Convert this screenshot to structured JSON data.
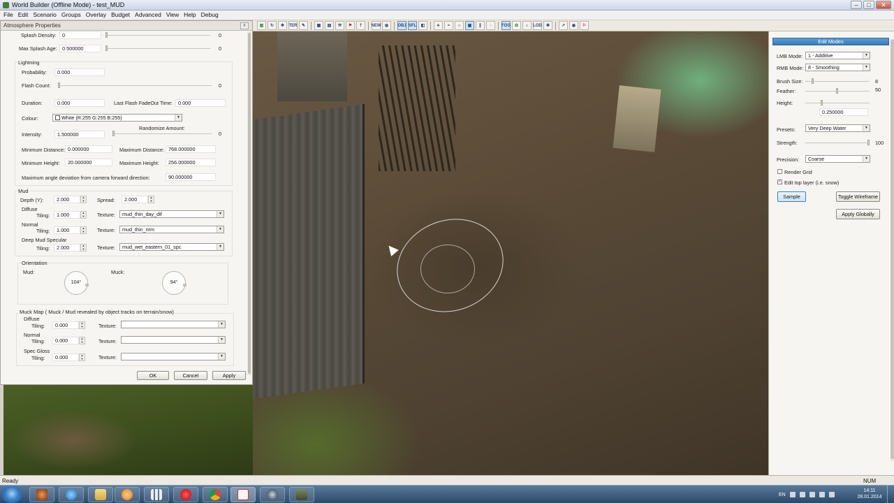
{
  "window": {
    "title": "World Builder (Offline Mode) - test_MUD"
  },
  "menu": [
    "File",
    "Edit",
    "Scenario",
    "Groups",
    "Overlay",
    "Budget",
    "Advanced",
    "View",
    "Help",
    "Debug"
  ],
  "toolbar_labels": {
    "ter": "TER",
    "new": "NEW",
    "obj": "OBJ",
    "sfl": "SFL",
    "fog": "FOG",
    "lod": "LOD"
  },
  "atmosphere": {
    "title": "Atmosphere Properties",
    "close": "x",
    "splash_density_label": "Splash Density:",
    "splash_density_value": "0",
    "splash_density_slider": "0",
    "max_splash_age_label": "Max Splash Age:",
    "max_splash_age_value": "0.500000",
    "max_splash_age_slider": "0",
    "lightning": {
      "section": "Lightning",
      "probability_label": "Probability:",
      "probability_value": "0.000",
      "flash_count_label": "Flash Count:",
      "flash_count_slider": "0",
      "duration_label": "Duration:",
      "duration_value": "0.000",
      "last_flash_label": "Last Flash FadeOut Time:",
      "last_flash_value": "0.000",
      "colour_label": "Colour:",
      "colour_value": "White (R:255 G:255 B:255)",
      "randomize_label": "Randomize Amount:",
      "intensity_label": "Intensity:",
      "intensity_value": "1.500000",
      "randomize_slider": "0",
      "min_distance_label": "Minimum Distance:",
      "min_distance_value": "0.000000",
      "max_distance_label": "Maximum Distance:",
      "max_distance_value": "768.000000",
      "min_height_label": "Minimum Height:",
      "min_height_value": "20.000000",
      "max_height_label": "Maximum Height:",
      "max_height_value": "256.000000",
      "max_angle_label": "Maximum angle deviation from camera forward direction:",
      "max_angle_value": "90.000000"
    },
    "mud": {
      "section": "Mud",
      "depth_label": "Depth (Y):",
      "depth_value": "2.000",
      "spread_label": "Spread:",
      "spread_value": "2.000",
      "diffuse_label": "Diffuse",
      "normal_label": "Normal",
      "deep_label": "Deep Mud Specular",
      "tiling_label": "Tiling:",
      "texture_label": "Texture:",
      "diffuse_tiling": "1.000",
      "diffuse_texture": "mud_thin_day_dif",
      "normal_tiling": "1.000",
      "normal_texture": "mud_thin_nrm",
      "deep_tiling": "2.000",
      "deep_texture": "mud_wet_eastern_01_spc"
    },
    "orientation": {
      "section": "Orientation",
      "mud1_label": "Mud:",
      "mud1_value": "104°",
      "mud2_label": "Muck:",
      "mud2_value": "94°"
    },
    "muck_map": {
      "section": "Muck Map ( Muck / Mud revealed by object tracks on terrain/snow)",
      "diffuse_label": "Diffuse",
      "normal_label": "Normal",
      "spec_label": "Spec Gloss",
      "tiling_label": "Tiling:",
      "texture_label": "Texture:",
      "diffuse_tiling": "0.000",
      "normal_tiling": "0.000",
      "spec_tiling": "0.000"
    },
    "buttons": {
      "ok": "OK",
      "cancel": "Cancel",
      "apply": "Apply"
    }
  },
  "edit_modes": {
    "header": "Edit Modes",
    "lmb_label": "LMB Mode:",
    "lmb_value": "1 - Additive",
    "rmb_label": "RMB Mode:",
    "rmb_value": "8 - Smoothing",
    "brush_size_label": "Brush Size:",
    "brush_size_value": "8",
    "brush_size_level": 0.1,
    "feather_label": "Feather:",
    "feather_value": "50",
    "feather_level": 0.5,
    "height_label": "Height:",
    "height_value": "0.250000",
    "presets_label": "Presets:",
    "presets_value": "Very Deep Water",
    "strength_label": "Strength:",
    "strength_value": "100",
    "precision_label": "Precision:",
    "precision_value": "Coarse",
    "render_grid_label": "Render Grid",
    "render_grid_checked": false,
    "edit_top_label": "Edit top layer (i.e. snow)",
    "edit_top_checked": true,
    "sample_button": "Sample",
    "toggle_wireframe_button": "Toggle Wireframe",
    "apply_globally_button": "Apply Globally"
  },
  "status": {
    "ready": "Ready",
    "num": "NUM"
  },
  "taskbar": {
    "lang": "EN",
    "time": "14:11",
    "date": "28.01.2014"
  }
}
